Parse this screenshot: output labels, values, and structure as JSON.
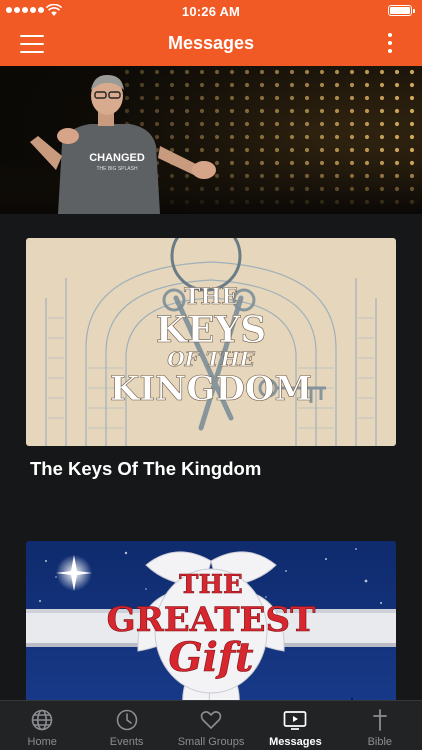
{
  "status_bar": {
    "time": "10:26 AM"
  },
  "header": {
    "title": "Messages"
  },
  "hero": {
    "shirt_text": "CHANGED",
    "shirt_subtext": "THE BIG SPLASH"
  },
  "messages": [
    {
      "title": "The Keys Of The Kingdom",
      "art_lines": [
        "THE",
        "KEYS",
        "OF THE",
        "KINGDOM"
      ]
    },
    {
      "title": "",
      "art_lines": [
        "THE",
        "GREATEST",
        "Gift"
      ]
    }
  ],
  "tabs": [
    {
      "label": "Home",
      "icon": "globe-icon",
      "active": false
    },
    {
      "label": "Events",
      "icon": "clock-icon",
      "active": false
    },
    {
      "label": "Small Groups",
      "icon": "heart-icon",
      "active": false
    },
    {
      "label": "Messages",
      "icon": "play-screen-icon",
      "active": true
    },
    {
      "label": "Bible",
      "icon": "cross-icon",
      "active": false
    }
  ],
  "colors": {
    "brand": "#f15a24",
    "background": "#161718",
    "tab_bar": "#222325",
    "tab_inactive": "#8b8d91"
  }
}
